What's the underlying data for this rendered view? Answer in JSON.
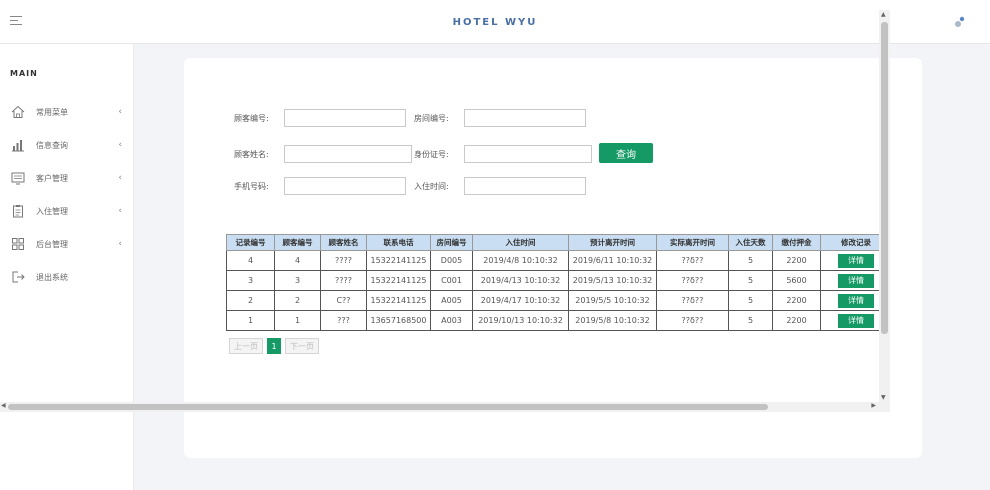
{
  "header": {
    "brand": "HOTEL WYU"
  },
  "sidebar": {
    "title": "MAIN",
    "items": [
      {
        "label": "常用菜单",
        "icon": "home-icon"
      },
      {
        "label": "信息查询",
        "icon": "chart-icon"
      },
      {
        "label": "客户管理",
        "icon": "monitor-icon"
      },
      {
        "label": "入住管理",
        "icon": "clipboard-icon"
      },
      {
        "label": "后台管理",
        "icon": "grid-icon"
      },
      {
        "label": "退出系统",
        "icon": "logout-icon"
      }
    ]
  },
  "search": {
    "customer_id_label": "顾客编号:",
    "room_id_label": "房间编号:",
    "customer_name_label": "顾客姓名:",
    "id_card_label": "身份证号:",
    "phone_label": "手机号码:",
    "checkin_time_label": "入住时间:",
    "query_button": "查询"
  },
  "table": {
    "headers": [
      "记录编号",
      "顾客编号",
      "顾客姓名",
      "联系电话",
      "房间编号",
      "入住时间",
      "预计离开时间",
      "实际离开时间",
      "入住天数",
      "缴付押金",
      "修改记录"
    ],
    "detail_label": "详情",
    "rows": [
      [
        "4",
        "4",
        "????",
        "15322141125",
        "D005",
        "2019/4/8 10:10:32",
        "2019/6/11 10:10:32",
        "??δ??",
        "5",
        "2200"
      ],
      [
        "3",
        "3",
        "????",
        "15322141125",
        "C001",
        "2019/4/13 10:10:32",
        "2019/5/13 10:10:32",
        "??δ??",
        "5",
        "5600"
      ],
      [
        "2",
        "2",
        "C??",
        "15322141125",
        "A005",
        "2019/4/17 10:10:32",
        "2019/5/5 10:10:32",
        "??δ??",
        "5",
        "2200"
      ],
      [
        "1",
        "1",
        "???",
        "13657168500",
        "A003",
        "2019/10/13 10:10:32",
        "2019/5/8 10:10:32",
        "??δ??",
        "5",
        "2200"
      ]
    ]
  },
  "pager": {
    "prev": "上一页",
    "current": "1",
    "next": "下一页"
  },
  "colors": {
    "accent": "#159a66",
    "header_bg": "#c9def2",
    "brand": "#4a6fa5"
  }
}
